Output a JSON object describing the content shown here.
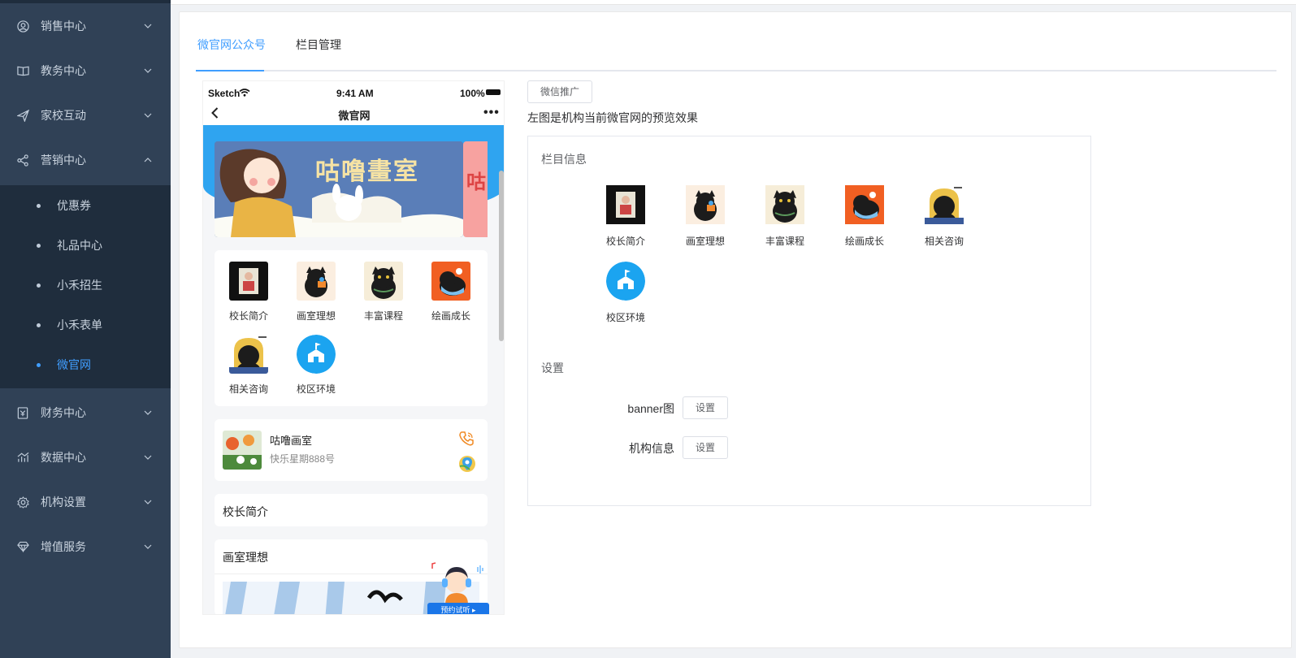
{
  "sidebar": {
    "menus": [
      {
        "label": "销售中心",
        "icon": "user-icon"
      },
      {
        "label": "教务中心",
        "icon": "book-icon"
      },
      {
        "label": "家校互动",
        "icon": "send-icon"
      },
      {
        "label": "营销中心",
        "icon": "share-icon"
      },
      {
        "label": "财务中心",
        "icon": "finance-icon"
      },
      {
        "label": "数据中心",
        "icon": "chart-icon"
      },
      {
        "label": "机构设置",
        "icon": "gear-icon"
      },
      {
        "label": "增值服务",
        "icon": "diamond-icon"
      }
    ],
    "submenu": [
      {
        "label": "优惠券"
      },
      {
        "label": "礼品中心"
      },
      {
        "label": "小禾招生"
      },
      {
        "label": "小禾表单"
      },
      {
        "label": "微官网"
      }
    ],
    "accent_color": "#409eff"
  },
  "tabs": [
    {
      "label": "微官网公众号"
    },
    {
      "label": "栏目管理"
    }
  ],
  "phone": {
    "status_left": "Sketch",
    "status_time": "9:41 AM",
    "status_battery": "100%",
    "nav_title": "微官网",
    "banner_text": "咕噜畫室",
    "banner_next_text": "咕",
    "grid": [
      {
        "label": "校长简介"
      },
      {
        "label": "画室理想"
      },
      {
        "label": "丰富课程"
      },
      {
        "label": "绘画成长"
      },
      {
        "label": "相关咨询"
      },
      {
        "label": "校区环境"
      }
    ],
    "org_name": "咕噜画室",
    "org_address": "快乐星期888号",
    "section1": "校长简介",
    "section2": "画室理想",
    "float_button": "预约试听"
  },
  "right": {
    "promo_button": "微信推广",
    "description": "左图是机构当前微官网的预览效果",
    "columns_title": "栏目信息",
    "columns": [
      {
        "label": "校长简介"
      },
      {
        "label": "画室理想"
      },
      {
        "label": "丰富课程"
      },
      {
        "label": "绘画成长"
      },
      {
        "label": "相关咨询"
      },
      {
        "label": "校区环境"
      }
    ],
    "settings_title": "设置",
    "settings": [
      {
        "label": "banner图",
        "button": "设置"
      },
      {
        "label": "机构信息",
        "button": "设置"
      }
    ]
  }
}
